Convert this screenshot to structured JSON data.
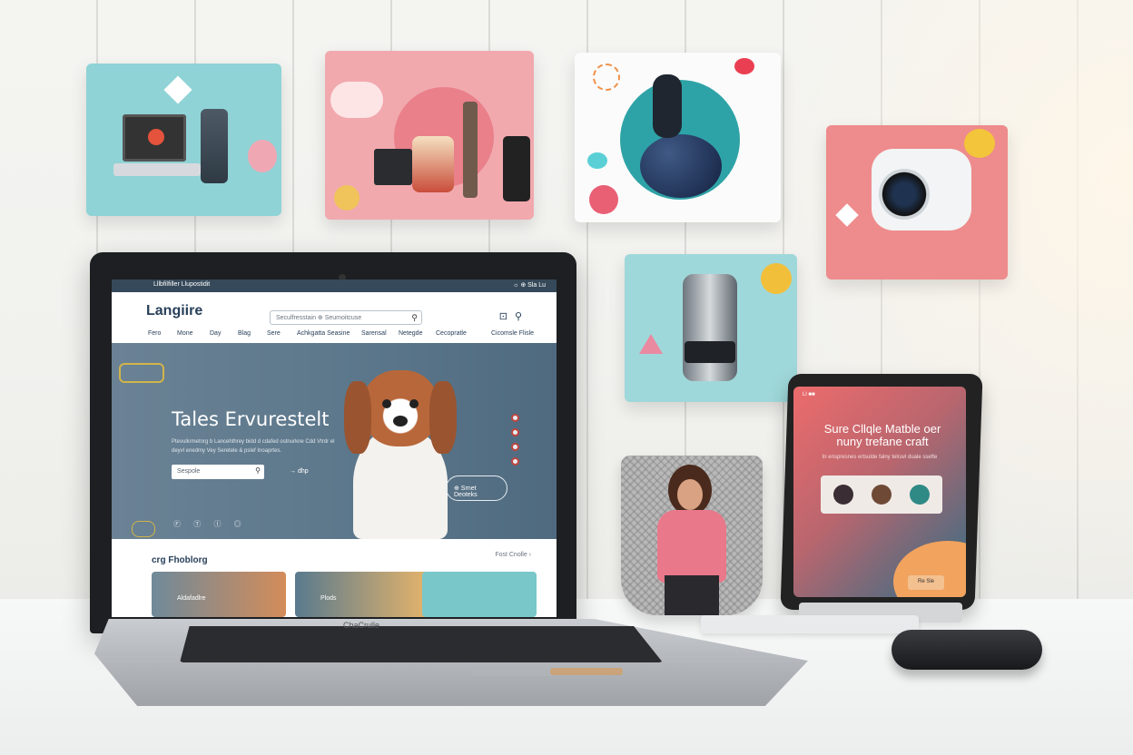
{
  "laptop_site": {
    "topbar_left": "Lllbfilfiller Llupostidit",
    "topbar_right": "☼   ⊕   Sla   Lu",
    "logo": "Langiire",
    "search_placeholder": "Seculfresstain  ⊕  Seumoitcuse",
    "nav": [
      "Fero",
      "Mone",
      "Day",
      "Blag",
      "Sere",
      "Achkgatta Seasine",
      "Sarensal",
      "Netegde",
      "Cecopratle",
      "Cicomsle Flisle"
    ],
    "hero_title": "Tales Ervurestelt",
    "hero_text": "Ptevulkrmetnrg b Lancehthrey bidd d cdafed ostnurkne Cdd Vtrdr el  deyvl enedmy Vey Seretele & pslef Inoaprtes.",
    "hero_input": "Sespole",
    "hero_arrow": "→ dhp",
    "hero_pill": "⊕ Srnet Deoteks",
    "hero_social": "Ⓕ Ⓣ Ⓘ ◎",
    "section_title": "crg Fhoblorg",
    "section_link": "Fost Cnolle ›",
    "cards": [
      "Aldafadlre",
      "Plods",
      ""
    ]
  },
  "laptop_brand": "ChaCrulle",
  "tablet": {
    "status": "Ll ■■",
    "title": "Sure Cllqle Matble oer nuny trefane craft",
    "subtitle": "In enspresnes ertsulde falny telruvl duale ssefte",
    "button": "Re Sle"
  }
}
